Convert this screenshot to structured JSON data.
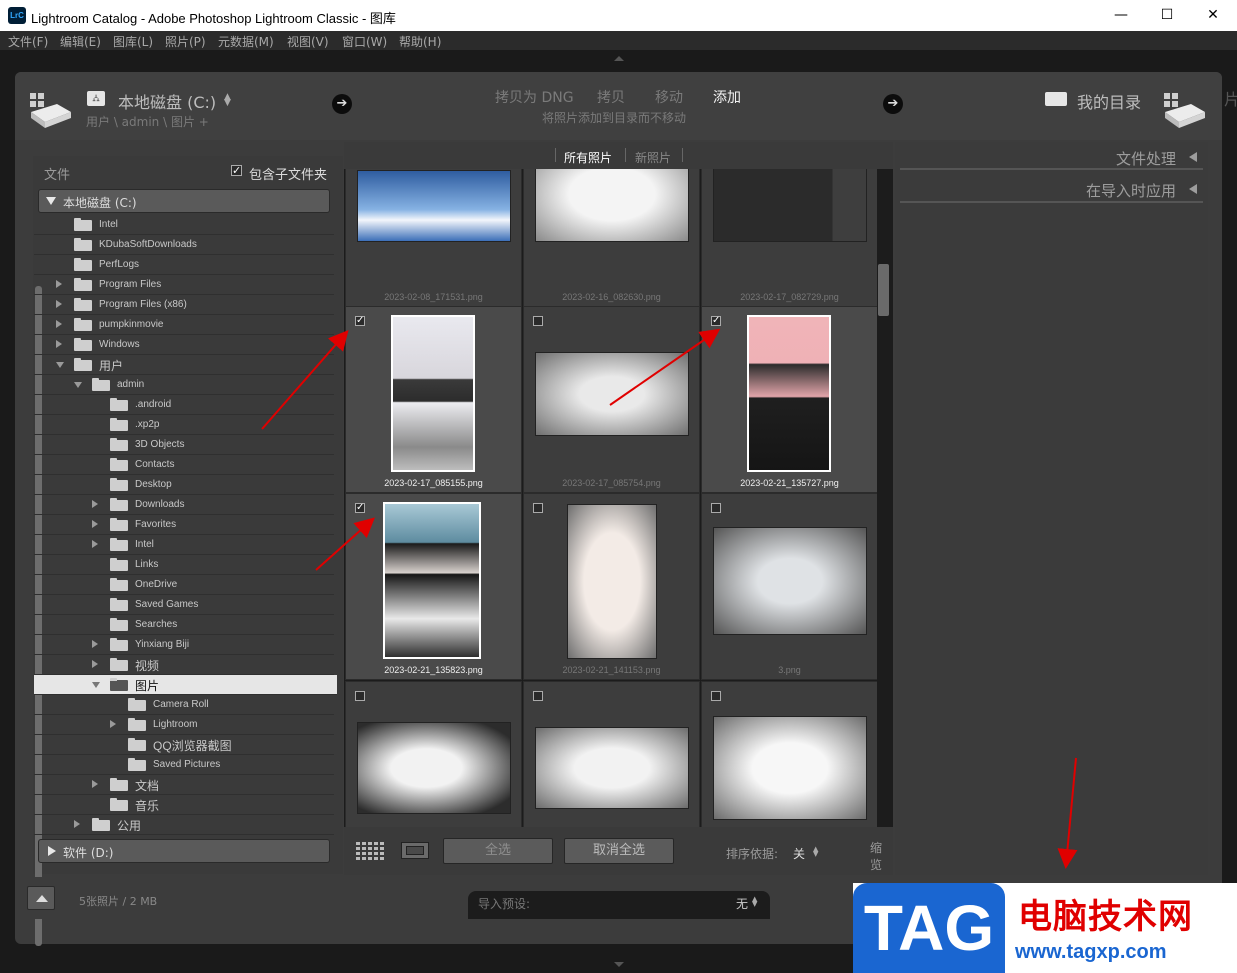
{
  "window": {
    "icon_text": "LrC",
    "title": "Lightroom Catalog - Adobe Photoshop Lightroom Classic - 图库",
    "minimize": "—",
    "maximize": "☐",
    "close": "✕"
  },
  "menu": [
    "文件(F)",
    "编辑(E)",
    "图库(L)",
    "照片(P)",
    "元数据(M)",
    "视图(V)",
    "窗口(W)",
    "帮助(H)"
  ],
  "header": {
    "source_drive": "本地磁盘 (C:)",
    "source_path": "用户 \\ admin \\ 图片 +",
    "modes": [
      "拷贝为 DNG",
      "拷贝",
      "移动",
      "添加"
    ],
    "active_mode": "添加",
    "mode_desc": "将照片添加到目录而不移动",
    "dest": "我的目录",
    "edge_char": "片"
  },
  "left": {
    "section_label": "文件",
    "include_sub": "包含子文件夹",
    "include_sub_checked": true,
    "volume_c": "本地磁盘 (C:)",
    "volume_d": "软件 (D:)",
    "tree": [
      {
        "label": "Intel",
        "depth": 0,
        "exp": "none"
      },
      {
        "label": "KDubaSoftDownloads",
        "depth": 0,
        "exp": "none"
      },
      {
        "label": "PerfLogs",
        "depth": 0,
        "exp": "none"
      },
      {
        "label": "Program Files",
        "depth": 0,
        "exp": "closed"
      },
      {
        "label": "Program Files (x86)",
        "depth": 0,
        "exp": "closed"
      },
      {
        "label": "pumpkinmovie",
        "depth": 0,
        "exp": "closed"
      },
      {
        "label": "Windows",
        "depth": 0,
        "exp": "closed"
      },
      {
        "label": "用户",
        "depth": 0,
        "exp": "open"
      },
      {
        "label": "admin",
        "depth": 1,
        "exp": "open"
      },
      {
        "label": ".android",
        "depth": 2,
        "exp": "none"
      },
      {
        "label": ".xp2p",
        "depth": 2,
        "exp": "none"
      },
      {
        "label": "3D Objects",
        "depth": 2,
        "exp": "none"
      },
      {
        "label": "Contacts",
        "depth": 2,
        "exp": "none"
      },
      {
        "label": "Desktop",
        "depth": 2,
        "exp": "none"
      },
      {
        "label": "Downloads",
        "depth": 2,
        "exp": "closed"
      },
      {
        "label": "Favorites",
        "depth": 2,
        "exp": "closed"
      },
      {
        "label": "Intel",
        "depth": 2,
        "exp": "closed"
      },
      {
        "label": "Links",
        "depth": 2,
        "exp": "none"
      },
      {
        "label": "OneDrive",
        "depth": 2,
        "exp": "none"
      },
      {
        "label": "Saved Games",
        "depth": 2,
        "exp": "none"
      },
      {
        "label": "Searches",
        "depth": 2,
        "exp": "none"
      },
      {
        "label": "Yinxiang Biji",
        "depth": 2,
        "exp": "closed"
      },
      {
        "label": "视频",
        "depth": 2,
        "exp": "closed"
      },
      {
        "label": "图片",
        "depth": 2,
        "exp": "open",
        "selected": true
      },
      {
        "label": "Camera Roll",
        "depth": 3,
        "exp": "none"
      },
      {
        "label": "Lightroom",
        "depth": 3,
        "exp": "closed"
      },
      {
        "label": "QQ浏览器截图",
        "depth": 3,
        "exp": "none"
      },
      {
        "label": "Saved Pictures",
        "depth": 3,
        "exp": "none"
      },
      {
        "label": "文档",
        "depth": 2,
        "exp": "closed"
      },
      {
        "label": "音乐",
        "depth": 2,
        "exp": "none"
      },
      {
        "label": "公用",
        "depth": 1,
        "exp": "closed"
      }
    ]
  },
  "grid": {
    "tabs": [
      "所有照片",
      "新照片"
    ],
    "active_tab": "所有照片",
    "cells": [
      {
        "name": "2023-02-08_171531.png",
        "checked": null,
        "kind": "sky"
      },
      {
        "name": "2023-02-16_082630.png",
        "checked": null,
        "kind": "doc"
      },
      {
        "name": "2023-02-17_082729.png",
        "checked": null,
        "kind": "dark"
      },
      {
        "name": "2023-02-17_085155.png",
        "checked": true,
        "kind": "portrait1"
      },
      {
        "name": "2023-02-17_085754.png",
        "checked": false,
        "kind": "screen"
      },
      {
        "name": "2023-02-21_135727.png",
        "checked": true,
        "kind": "portrait2"
      },
      {
        "name": "2023-02-21_135823.png",
        "checked": true,
        "kind": "portrait3"
      },
      {
        "name": "2023-02-21_141153.png",
        "checked": false,
        "kind": "card"
      },
      {
        "name": "3.png",
        "checked": false,
        "kind": "app"
      },
      {
        "name": "",
        "checked": false,
        "kind": "app2"
      },
      {
        "name": "",
        "checked": false,
        "kind": "doc2"
      },
      {
        "name": "",
        "checked": false,
        "kind": "sheet"
      }
    ],
    "check_all": "全选",
    "uncheck_all": "取消全选",
    "sort_label": "排序依据:",
    "sort_value": "关",
    "thumb_label": "缩览"
  },
  "right": {
    "file_handling": "文件处理",
    "apply_during_import": "在导入时应用"
  },
  "footer": {
    "count": "5张照片 / 2 MB",
    "preset_label": "导入预设:",
    "preset_value": "无"
  },
  "watermark": {
    "tag": "TAG",
    "site_name": "电脑技术网",
    "url": "www.tagxp.com"
  },
  "colors": {
    "accent_red": "#e00000",
    "tag_blue": "#1a66d1"
  }
}
